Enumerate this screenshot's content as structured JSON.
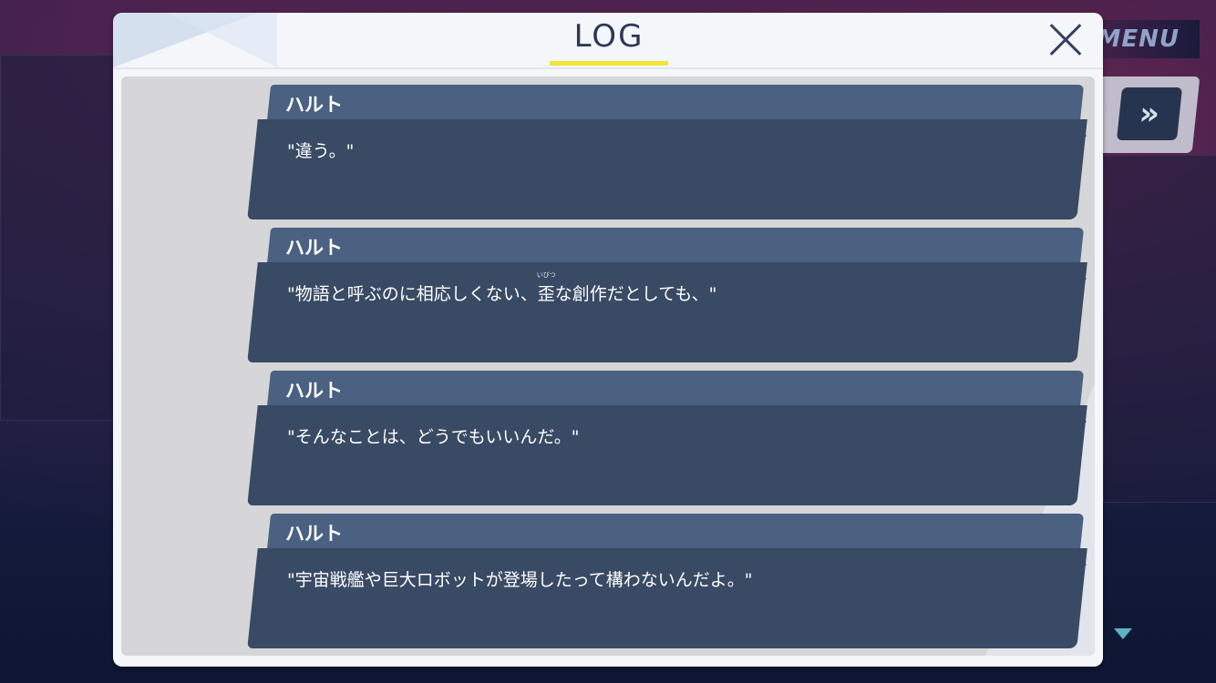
{
  "log": {
    "title": "LOG",
    "entries": [
      {
        "speaker": "ハルト",
        "text": "\"違う。\""
      },
      {
        "speaker": "ハルト",
        "text_before": "\"物語と呼ぶのに相応しくない、",
        "ruby_base": "歪",
        "ruby_text": "いびつ",
        "text_after": "な創作だとしても、\""
      },
      {
        "speaker": "ハルト",
        "text": "\"そんなことは、どうでもいいんだ。\""
      },
      {
        "speaker": "ハルト",
        "text": "\"宇宙戦艦や巨大ロボットが登場したって構わないんだよ。\""
      }
    ]
  },
  "hud": {
    "menu_label": "MENU",
    "fast_forward_glyph": "»"
  },
  "icons": {
    "close": "close-icon",
    "scroll_down": "triangle-down-icon",
    "fast_forward": "fast-forward-icon"
  },
  "colors": {
    "speaker_bar": "#4a6182",
    "message_body": "#394a64",
    "title_underline": "#f2e53a",
    "scroll_indicator": "#5fb2c4"
  }
}
